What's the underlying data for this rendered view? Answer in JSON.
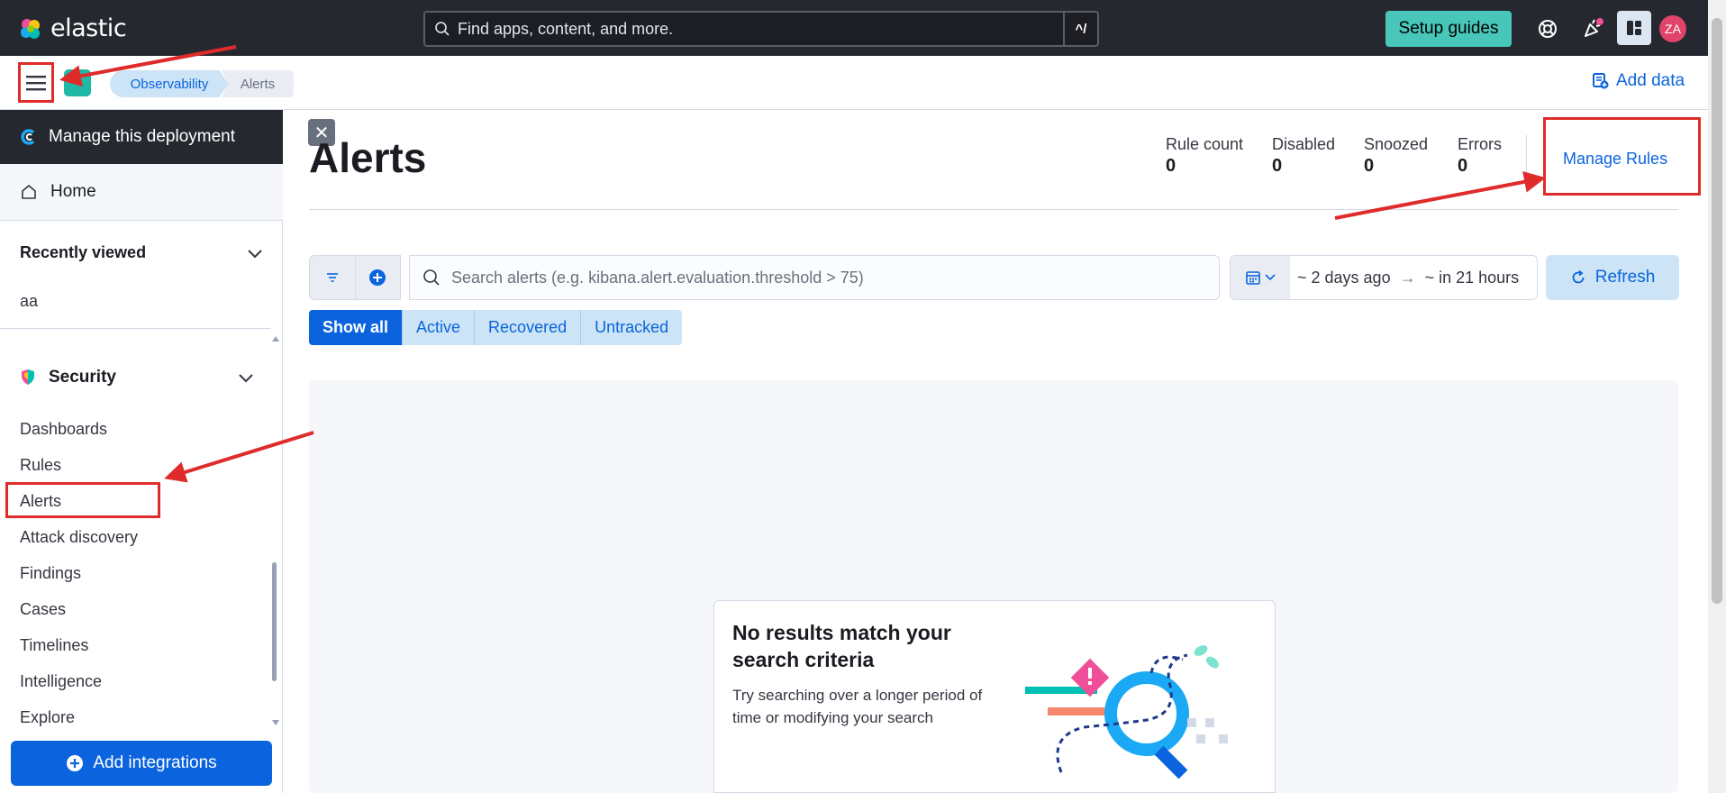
{
  "header": {
    "brand": "elastic",
    "search_placeholder": "Find apps, content, and more.",
    "search_shortcut": "^/",
    "setup_guides": "Setup guides",
    "avatar_initials": "ZA"
  },
  "subbar": {
    "breadcrumbs": [
      "Observability",
      "Alerts"
    ],
    "add_data": "Add data"
  },
  "sidebar": {
    "manage_deployment": "Manage this deployment",
    "home": "Home",
    "recently_viewed": "Recently viewed",
    "recent_items": [
      "aa"
    ],
    "security": "Security",
    "security_items": [
      "Dashboards",
      "Rules",
      "Alerts",
      "Attack discovery",
      "Findings",
      "Cases",
      "Timelines",
      "Intelligence",
      "Explore"
    ],
    "add_integrations": "Add integrations"
  },
  "main": {
    "title": "Alerts",
    "stats": [
      {
        "label": "Rule count",
        "value": "0"
      },
      {
        "label": "Disabled",
        "value": "0"
      },
      {
        "label": "Snoozed",
        "value": "0"
      },
      {
        "label": "Errors",
        "value": "0"
      }
    ],
    "manage_rules": "Manage Rules",
    "query_placeholder": "Search alerts (e.g. kibana.alert.evaluation.threshold > 75)",
    "date_start": "~ 2 days ago",
    "date_arrow": "→",
    "date_end": "~ in 21 hours",
    "refresh": "Refresh",
    "status_tabs": [
      "Show all",
      "Active",
      "Recovered",
      "Untracked"
    ],
    "empty_title": "No results match your search criteria",
    "empty_body": "Try searching over a longer period of time or modifying your search"
  },
  "colors": {
    "header_bg": "#25282f",
    "accent": "#0b64dd",
    "annotation_red": "#e02b2b",
    "setup_green": "#48c6b9"
  }
}
